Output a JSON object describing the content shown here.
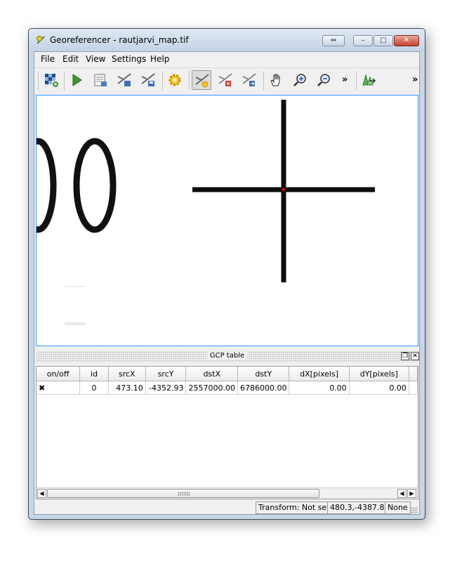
{
  "window": {
    "title": "Georeferencer - rautjarvi_map.tif"
  },
  "menu": [
    "File",
    "Edit",
    "View",
    "Settings",
    "Help"
  ],
  "toolbar": {
    "more": "»",
    "tools": [
      "open-raster-icon",
      "start-georeferencing-icon",
      "generate-gdal-script-icon",
      "load-gcp-points-icon",
      "save-gcp-points-icon",
      "transformation-settings-icon",
      "add-point-icon",
      "delete-point-icon",
      "move-gcp-point-icon",
      "pan-icon",
      "zoom-in-icon",
      "zoom-out-icon",
      "link-georeferencer-to-qgis-icon"
    ]
  },
  "gcp_table": {
    "title": "GCP table",
    "columns": [
      "on/off",
      "id",
      "srcX",
      "srcY",
      "dstX",
      "dstY",
      "dX[pixels]",
      "dY[pixels]"
    ],
    "rows": [
      {
        "on": "✖",
        "id": "0",
        "srcX": "473.10",
        "srcY": "-4352.93",
        "dstX": "2557000.00",
        "dstY": "6786000.00",
        "dX": "0.00",
        "dY": "0.00"
      }
    ]
  },
  "status": {
    "transform": "Transform: Not set",
    "coords": "480.3,-4387.8",
    "crs": "None"
  },
  "canvas": {
    "map_text": "00"
  },
  "colors": {
    "selection": "#3399ff",
    "gcp_marker": "#ff0000",
    "close_button": "#c5422f"
  }
}
